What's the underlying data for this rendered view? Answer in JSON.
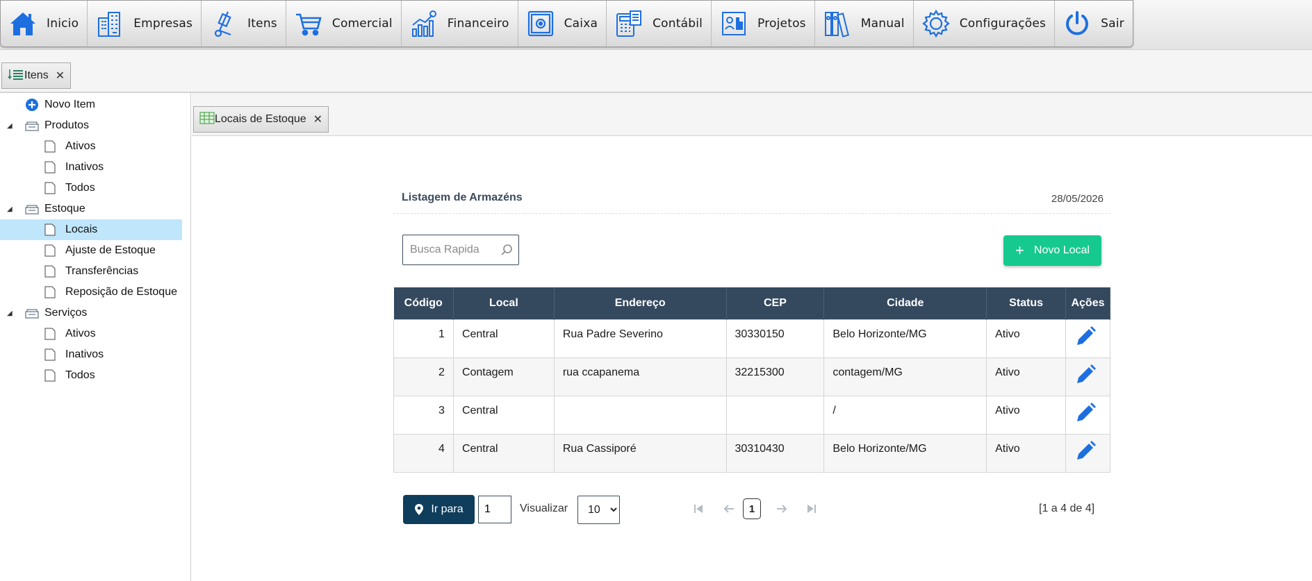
{
  "menu": {
    "items": [
      {
        "label": "Inicio",
        "icon": "home-icon"
      },
      {
        "label": "Empresas",
        "icon": "buildings-icon"
      },
      {
        "label": "Itens",
        "icon": "hand-truck-icon"
      },
      {
        "label": "Comercial",
        "icon": "shopping-cart-icon"
      },
      {
        "label": "Financeiro",
        "icon": "finance-chart-icon"
      },
      {
        "label": "Caixa",
        "icon": "safe-icon"
      },
      {
        "label": "Contábil",
        "icon": "calculator-icon"
      },
      {
        "label": "Projetos",
        "icon": "project-board-icon"
      },
      {
        "label": "Manual",
        "icon": "binders-icon"
      },
      {
        "label": "Configurações",
        "icon": "gear-icon"
      },
      {
        "label": "Sair",
        "icon": "power-icon"
      }
    ]
  },
  "module_tab": {
    "label": "Itens"
  },
  "tree": {
    "new_item": "Novo Item",
    "produtos": {
      "label": "Produtos",
      "children": [
        "Ativos",
        "Inativos",
        "Todos"
      ]
    },
    "estoque": {
      "label": "Estoque",
      "children": [
        "Locais",
        "Ajuste de Estoque",
        "Transferências",
        "Reposição de Estoque"
      ]
    },
    "servicos": {
      "label": "Serviços",
      "children": [
        "Ativos",
        "Inativos",
        "Todos"
      ]
    },
    "selected": "Locais"
  },
  "inner_tab": {
    "label": "Locais de Estoque"
  },
  "panel": {
    "title": "Listagem de Armazéns",
    "date": "28/05/2026"
  },
  "search": {
    "placeholder": "Busca Rapida"
  },
  "new_local_button": {
    "label": "Novo Local"
  },
  "table": {
    "columns": [
      "Código",
      "Local",
      "Endereço",
      "CEP",
      "Cidade",
      "Status",
      "Ações"
    ],
    "rows": [
      {
        "codigo": "1",
        "local": "Central",
        "endereco": "Rua Padre Severino",
        "cep": "30330150",
        "cidade": "Belo Horizonte/MG",
        "status": "Ativo"
      },
      {
        "codigo": "2",
        "local": "Contagem",
        "endereco": "rua ccapanema",
        "cep": "32215300",
        "cidade": "contagem/MG",
        "status": "Ativo"
      },
      {
        "codigo": "3",
        "local": "Central",
        "endereco": "",
        "cep": "",
        "cidade": "/",
        "status": "Ativo"
      },
      {
        "codigo": "4",
        "local": "Central",
        "endereco": "Rua Cassiporé",
        "cep": "30310430",
        "cidade": "Belo Horizonte/MG",
        "status": "Ativo"
      }
    ]
  },
  "pagination": {
    "goto_label": "Ir para",
    "page_input_value": "1",
    "view_label": "Visualizar",
    "page_size": "10",
    "current_page": "1",
    "summary": "[1 a 4 de 4]"
  },
  "colors": {
    "header_dark": "#34495e",
    "accent_green": "#16c98f",
    "goto_button": "#0f3d5c",
    "selected_row": "#bfe6fb",
    "icon_blue": "#1d6fe0"
  }
}
